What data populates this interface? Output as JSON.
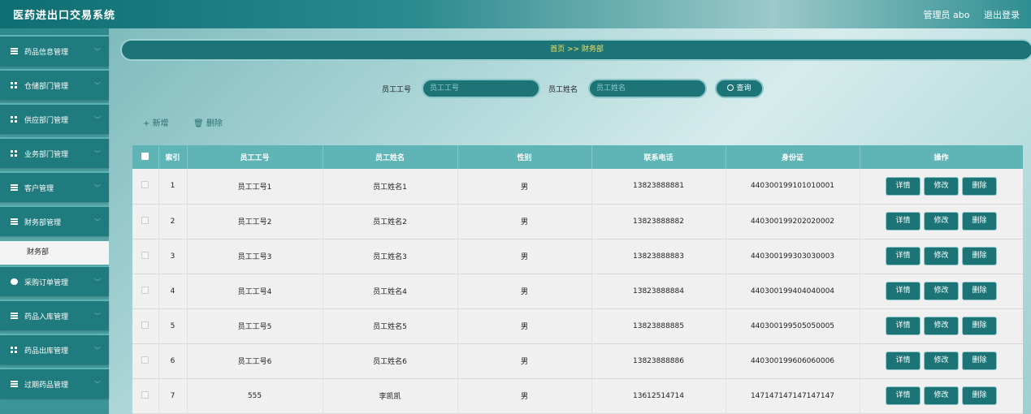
{
  "header": {
    "title": "医药进出口交易系统",
    "user": "管理员 abo",
    "logout": "退出登录"
  },
  "sidebar": {
    "items": [
      {
        "label": "药品信息管理",
        "icon": "list-icon"
      },
      {
        "label": "仓储部门管理",
        "icon": "grid-icon"
      },
      {
        "label": "供应部门管理",
        "icon": "grid-icon"
      },
      {
        "label": "业务部门管理",
        "icon": "grid-icon"
      },
      {
        "label": "客户管理",
        "icon": "list-icon"
      },
      {
        "label": "财务部管理",
        "icon": "list-icon"
      },
      {
        "label": "采购订单管理",
        "icon": "pin-icon"
      },
      {
        "label": "药品入库管理",
        "icon": "list-icon"
      },
      {
        "label": "药品出库管理",
        "icon": "grid-icon"
      },
      {
        "label": "过期药品管理",
        "icon": "list-icon"
      }
    ],
    "active_sub": "财务部"
  },
  "breadcrumb": {
    "text": "首页 >> 财务部"
  },
  "search": {
    "id_label": "员工工号",
    "id_placeholder": "员工工号",
    "name_label": "员工姓名",
    "name_placeholder": "员工姓名",
    "button": "查询"
  },
  "actions": {
    "add": "+ 新增",
    "delete": "删除"
  },
  "table": {
    "columns": [
      "索引",
      "员工工号",
      "员工姓名",
      "性别",
      "联系电话",
      "身份证",
      "操作"
    ],
    "rows": [
      {
        "index": "1",
        "id": "员工工号1",
        "name": "员工姓名1",
        "gender": "男",
        "phone": "13823888881",
        "idcard": "440300199101010001"
      },
      {
        "index": "2",
        "id": "员工工号2",
        "name": "员工姓名2",
        "gender": "男",
        "phone": "13823888882",
        "idcard": "440300199202020002"
      },
      {
        "index": "3",
        "id": "员工工号3",
        "name": "员工姓名3",
        "gender": "男",
        "phone": "13823888883",
        "idcard": "440300199303030003"
      },
      {
        "index": "4",
        "id": "员工工号4",
        "name": "员工姓名4",
        "gender": "男",
        "phone": "13823888884",
        "idcard": "440300199404040004"
      },
      {
        "index": "5",
        "id": "员工工号5",
        "name": "员工姓名5",
        "gender": "男",
        "phone": "13823888885",
        "idcard": "440300199505050005"
      },
      {
        "index": "6",
        "id": "员工工号6",
        "name": "员工姓名6",
        "gender": "男",
        "phone": "13823888886",
        "idcard": "440300199606060006"
      },
      {
        "index": "7",
        "id": "555",
        "name": "李凯凯",
        "gender": "男",
        "phone": "13612514714",
        "idcard": "147147147147147147"
      }
    ],
    "ops": {
      "detail": "详情",
      "edit": "修改",
      "remove": "删除"
    }
  }
}
